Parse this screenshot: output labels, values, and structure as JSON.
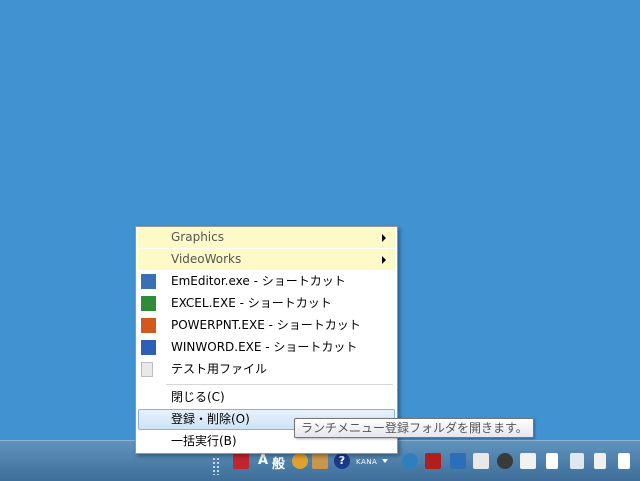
{
  "menu": {
    "folders": [
      {
        "label": "Graphics"
      },
      {
        "label": "VideoWorks"
      }
    ],
    "shortcuts": [
      {
        "label": "EmEditor.exe - ショートカット",
        "icon": "emeditor-icon",
        "color": "#3a6fb3"
      },
      {
        "label": "EXCEL.EXE - ショートカット",
        "icon": "excel-icon",
        "color": "#2f8a3a"
      },
      {
        "label": "POWERPNT.EXE - ショートカット",
        "icon": "powerpoint-icon",
        "color": "#d2581f"
      },
      {
        "label": "WINWORD.EXE - ショートカット",
        "icon": "word-icon",
        "color": "#2f5fb3"
      },
      {
        "label": "テスト用ファイル",
        "icon": "file-icon",
        "color": "#e0e0e0"
      }
    ],
    "commands": [
      {
        "label": "閉じる(C)"
      },
      {
        "label": "登録・削除(O)"
      },
      {
        "label": "一括実行(B)"
      }
    ]
  },
  "tooltip": {
    "text": "ランチメニュー登録フォルダを開きます。"
  },
  "taskbar": {
    "ime_mode": "A",
    "ime_dict": "般",
    "ime_kana": "KANA"
  },
  "colors": {
    "desktop": "#4192d0",
    "folder_highlight": "#fdfac8",
    "selected": "#cfe3f7"
  }
}
